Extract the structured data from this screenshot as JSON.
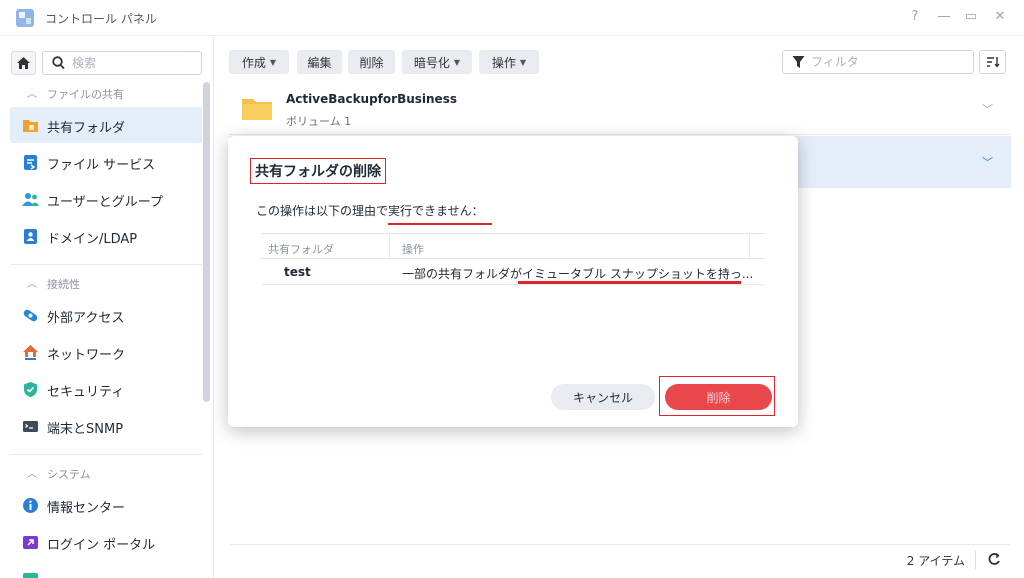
{
  "window": {
    "title": "コントロール パネル",
    "controls": {
      "help": "?",
      "minimize": "—",
      "maximize": "▭",
      "close": "✕"
    }
  },
  "sidebar": {
    "search_placeholder": "検索",
    "sections": [
      {
        "label": "ファイルの共有",
        "items": [
          {
            "label": "共有フォルダ",
            "icon": "shared-folder-icon",
            "color": "#f0a32b",
            "active": true
          },
          {
            "label": "ファイル サービス",
            "icon": "file-services-icon",
            "color": "#2a7fd4"
          },
          {
            "label": "ユーザーとグループ",
            "icon": "users-groups-icon",
            "color": "#2a9bd8"
          },
          {
            "label": "ドメイン/LDAP",
            "icon": "domain-ldap-icon",
            "color": "#2a7fd4"
          }
        ]
      },
      {
        "label": "接続性",
        "items": [
          {
            "label": "外部アクセス",
            "icon": "external-access-icon",
            "color": "#2a86d6"
          },
          {
            "label": "ネットワーク",
            "icon": "network-icon",
            "color": "#e06a3a"
          },
          {
            "label": "セキュリティ",
            "icon": "security-icon",
            "color": "#2bb59a"
          },
          {
            "label": "端末とSNMP",
            "icon": "terminal-snmp-icon",
            "color": "#3d4a5a"
          }
        ]
      },
      {
        "label": "システム",
        "items": [
          {
            "label": "情報センター",
            "icon": "info-center-icon",
            "color": "#2a7fd4"
          },
          {
            "label": "ログイン ポータル",
            "icon": "login-portal-icon",
            "color": "#7b3ad0"
          }
        ]
      }
    ]
  },
  "toolbar": {
    "create": "作成",
    "edit": "編集",
    "delete": "削除",
    "encrypt": "暗号化",
    "action": "操作",
    "filter_placeholder": "フィルタ"
  },
  "list": {
    "rows": [
      {
        "name": "ActiveBackupforBusiness",
        "volume": "ボリューム 1"
      },
      {
        "name": "",
        "volume": ""
      }
    ]
  },
  "status": {
    "count": "2 アイテム"
  },
  "dialog": {
    "title": "共有フォルダの削除",
    "message_prefix": "この操作は以下の理由で",
    "message_emphasis": "実行できません：",
    "table": {
      "headers": [
        "共有フォルダ",
        "操作"
      ],
      "rows": [
        {
          "folder": "test",
          "reason": "一部の共有フォルダがイミュータブル スナップショットを持っ..."
        }
      ]
    },
    "cancel_label": "キャンセル",
    "delete_label": "削除"
  },
  "colors": {
    "accent": "#e3eef9",
    "danger": "#e8484c",
    "highlight": "#e0242c"
  }
}
